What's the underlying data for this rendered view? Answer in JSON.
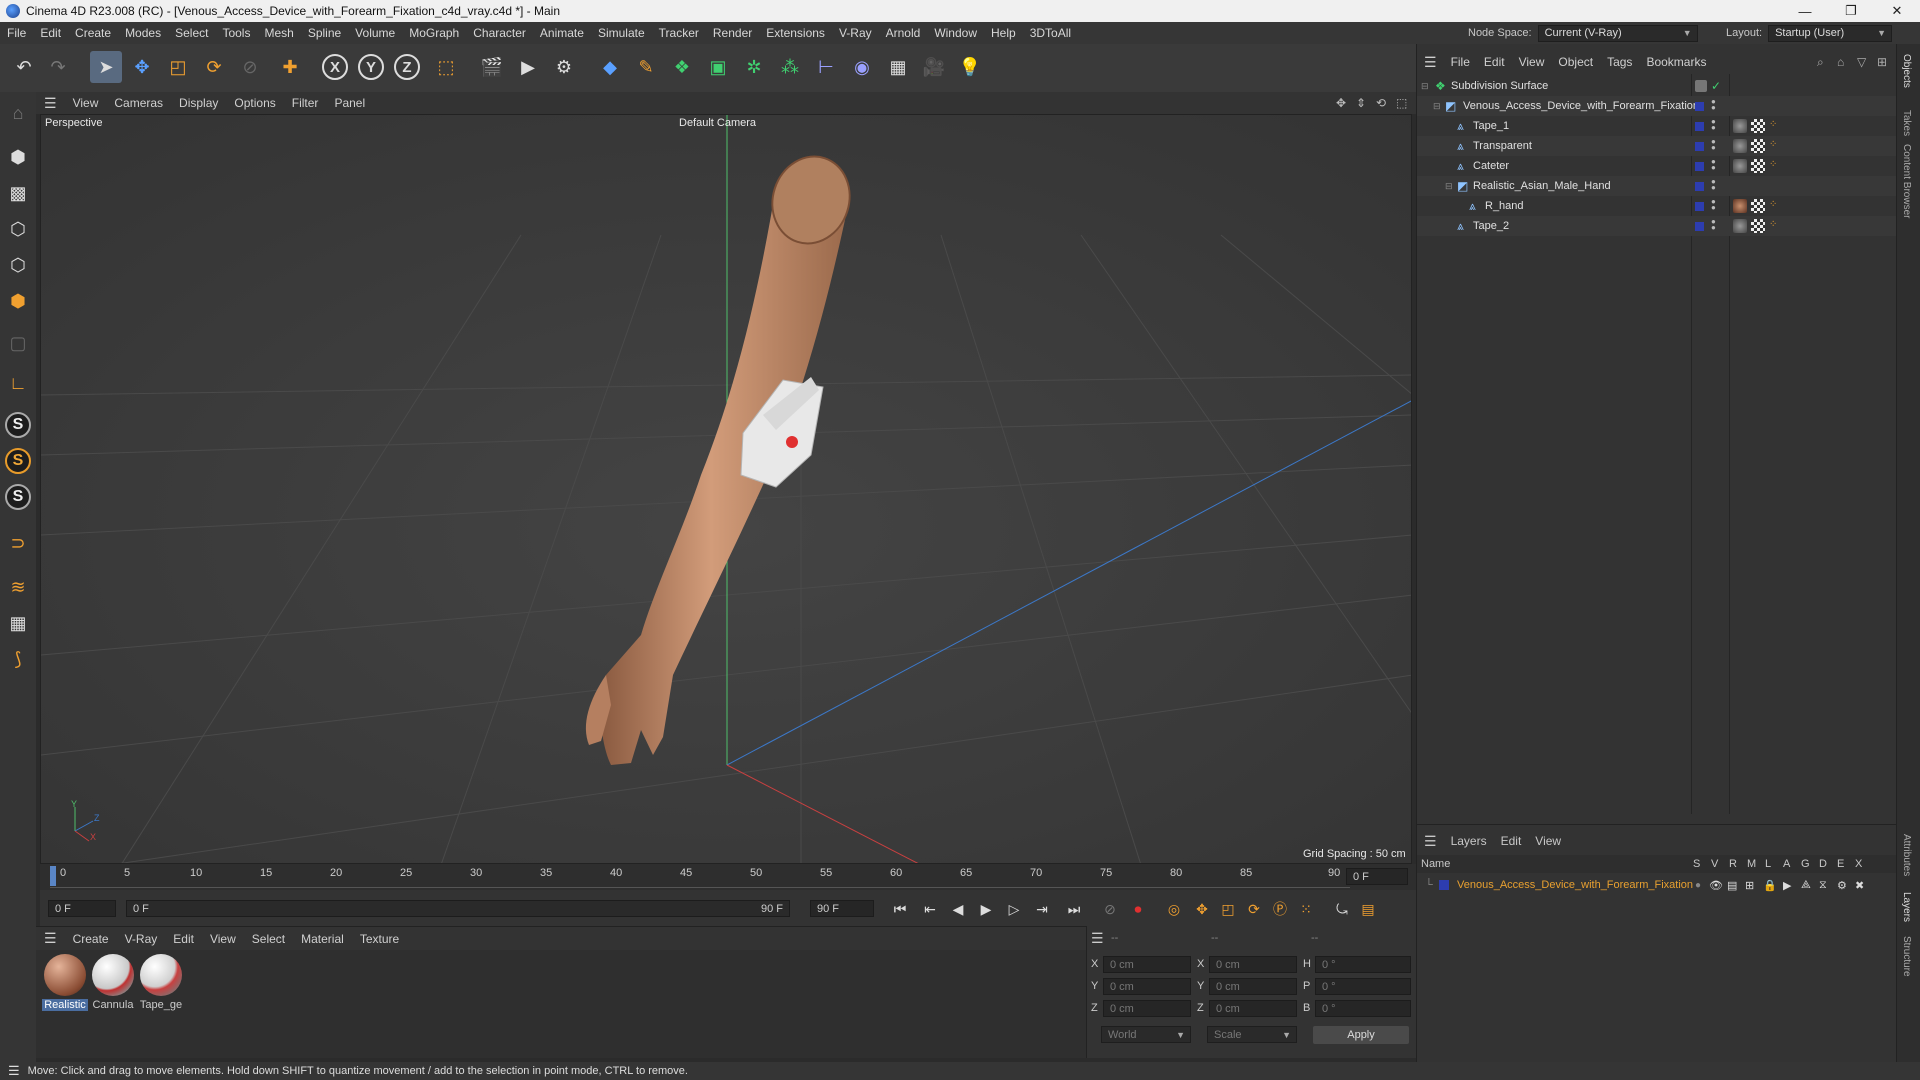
{
  "titlebar": {
    "title": "Cinema 4D R23.008 (RC) - [Venous_Access_Device_with_Forearm_Fixation_c4d_vray.c4d *] - Main",
    "controls": [
      "—",
      "❐",
      "✕"
    ]
  },
  "menubar": {
    "items": [
      "File",
      "Edit",
      "Create",
      "Modes",
      "Select",
      "Tools",
      "Mesh",
      "Spline",
      "Volume",
      "MoGraph",
      "Character",
      "Animate",
      "Simulate",
      "Tracker",
      "Render",
      "Extensions",
      "V-Ray",
      "Arnold",
      "Window",
      "Help",
      "3DToAll"
    ],
    "node_space_label": "Node Space:",
    "node_space_value": "Current (V-Ray)",
    "layout_label": "Layout:",
    "layout_value": "Startup (User)"
  },
  "toolbar": {
    "axes": [
      "X",
      "Y",
      "Z"
    ]
  },
  "viewport": {
    "menu": [
      "View",
      "Cameras",
      "Display",
      "Options",
      "Filter",
      "Panel"
    ],
    "view_name": "Perspective",
    "camera_name": "Default Camera",
    "grid_spacing": "Grid Spacing : 50 cm",
    "axis_labels": {
      "y": "Y",
      "z": "Z",
      "x": "X"
    }
  },
  "timeline": {
    "ticks": [
      "0",
      "5",
      "10",
      "15",
      "20",
      "25",
      "30",
      "35",
      "40",
      "45",
      "50",
      "55",
      "60",
      "65",
      "70",
      "75",
      "80",
      "85",
      "90"
    ],
    "current_frame": "0 F",
    "start_field": "0 F",
    "range_start": "0 F",
    "range_end": "90 F",
    "end_field": "90 F"
  },
  "material_manager": {
    "menu": [
      "Create",
      "V-Ray",
      "Edit",
      "View",
      "Select",
      "Material",
      "Texture"
    ],
    "materials": [
      {
        "name": "Realistic",
        "selected": true
      },
      {
        "name": "Cannula",
        "selected": false
      },
      {
        "name": "Tape_ge",
        "selected": false
      }
    ]
  },
  "coordinates": {
    "headers": [
      "--",
      "--",
      "--"
    ],
    "rows": [
      {
        "pos_label": "X",
        "pos": "0 cm",
        "size_label": "X",
        "size": "0 cm",
        "rot_label": "H",
        "rot": "0 °"
      },
      {
        "pos_label": "Y",
        "pos": "0 cm",
        "size_label": "Y",
        "size": "0 cm",
        "rot_label": "P",
        "rot": "0 °"
      },
      {
        "pos_label": "Z",
        "pos": "0 cm",
        "size_label": "Z",
        "size": "0 cm",
        "rot_label": "B",
        "rot": "0 °"
      }
    ],
    "space": "World",
    "mode": "Scale",
    "apply": "Apply"
  },
  "object_manager": {
    "menu": [
      "File",
      "Edit",
      "View",
      "Object",
      "Tags",
      "Bookmarks"
    ],
    "objects": [
      {
        "name": "Subdivision Surface",
        "icon": "subdivision-icon"
      },
      {
        "name": "Venous_Access_Device_with_Forearm_Fixation",
        "icon": "null-object-icon"
      },
      {
        "name": "Tape_1",
        "icon": "polygon-object-icon"
      },
      {
        "name": "Transparent",
        "icon": "polygon-object-icon"
      },
      {
        "name": "Cateter",
        "icon": "polygon-object-icon"
      },
      {
        "name": "Realistic_Asian_Male_Hand",
        "icon": "null-object-icon"
      },
      {
        "name": "R_hand",
        "icon": "polygon-object-icon"
      },
      {
        "name": "Tape_2",
        "icon": "polygon-object-icon"
      }
    ]
  },
  "layer_manager": {
    "menu": [
      "Layers",
      "Edit",
      "View"
    ],
    "name_header": "Name",
    "flag_headers": [
      "S",
      "V",
      "R",
      "M",
      "L",
      "A",
      "G",
      "D",
      "E",
      "X"
    ],
    "layers": [
      {
        "name": "Venous_Access_Device_with_Forearm_Fixation",
        "color": "#2d3db0"
      }
    ]
  },
  "side_tabs": [
    "Objects",
    "Takes",
    "Content Browser",
    "Attributes",
    "Layers",
    "Structure"
  ],
  "statusbar": {
    "text": "Move: Click and drag to move elements. Hold down SHIFT to quantize movement / add to the selection in point mode, CTRL to remove."
  },
  "colors": {
    "accent_orange": "#e8a030",
    "selection_blue": "#4a6da0",
    "layer_blue": "#2d3db0",
    "skin": "#c9906e"
  }
}
